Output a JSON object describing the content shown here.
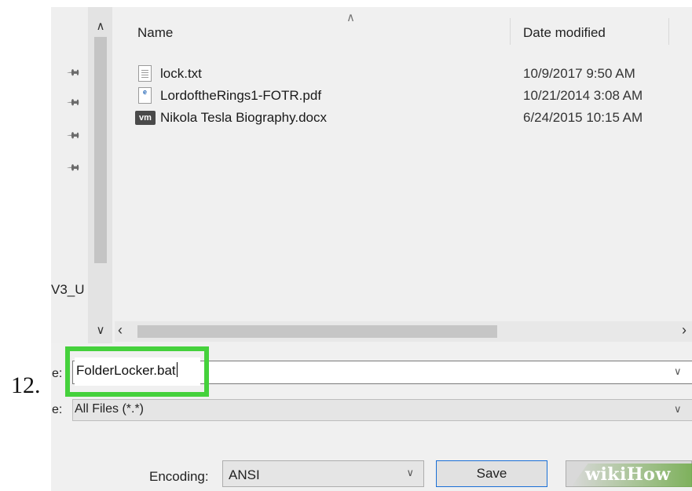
{
  "step": {
    "number": "12."
  },
  "nav": {
    "truncated_label": "V3_U"
  },
  "file_list": {
    "columns": {
      "name": "Name",
      "date_modified": "Date modified"
    },
    "files": [
      {
        "name": "lock.txt",
        "date": "10/9/2017 9:50 AM",
        "icon": "text-file-icon"
      },
      {
        "name": "LordoftheRings1-FOTR.pdf",
        "date": "10/21/2014 3:08 AM",
        "icon": "pdf-file-icon"
      },
      {
        "name": "Nikola Tesla Biography.docx",
        "date": "6/24/2015 10:15 AM",
        "icon": "vm-file-icon",
        "icon_text": "vm"
      }
    ]
  },
  "form": {
    "filename_label": "e:",
    "filename_value": "FolderLocker.bat",
    "type_label": "e:",
    "type_value": "All Files  (*.*)",
    "encoding_label": "Encoding:",
    "encoding_value": "ANSI",
    "save_label": "Save"
  },
  "pdf_icon_text": "e",
  "watermark": "wikiHow",
  "colors": {
    "highlight": "#45d13c",
    "save_border": "#1a6fd6"
  }
}
